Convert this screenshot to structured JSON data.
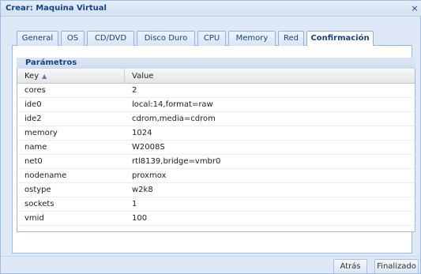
{
  "window": {
    "title": "Crear: Maquina Virtual",
    "close_glyph": "×"
  },
  "tabs": [
    {
      "label": "General",
      "active": false
    },
    {
      "label": "OS",
      "active": false
    },
    {
      "label": "CD/DVD",
      "active": false
    },
    {
      "label": "Disco Duro",
      "active": false
    },
    {
      "label": "CPU",
      "active": false
    },
    {
      "label": "Memory",
      "active": false
    },
    {
      "label": "Red",
      "active": false
    },
    {
      "label": "Confirmación",
      "active": true
    }
  ],
  "fieldset": {
    "title": "Parámetros"
  },
  "grid": {
    "columns": {
      "key": "Key",
      "value": "Value",
      "sort_glyph": "▲"
    },
    "rows": [
      {
        "key": "cores",
        "value": "2"
      },
      {
        "key": "ide0",
        "value": "local:14,format=raw"
      },
      {
        "key": "ide2",
        "value": "cdrom,media=cdrom"
      },
      {
        "key": "memory",
        "value": "1024"
      },
      {
        "key": "name",
        "value": "W2008S"
      },
      {
        "key": "net0",
        "value": "rtl8139,bridge=vmbr0"
      },
      {
        "key": "nodename",
        "value": "proxmox"
      },
      {
        "key": "ostype",
        "value": "w2k8"
      },
      {
        "key": "sockets",
        "value": "1"
      },
      {
        "key": "vmid",
        "value": "100"
      }
    ]
  },
  "buttons": {
    "back": "Atrás",
    "finish": "Finalizado"
  },
  "colors": {
    "accent": "#15428b",
    "window_bg": "#dfe8f6",
    "border": "#99bbe8"
  }
}
